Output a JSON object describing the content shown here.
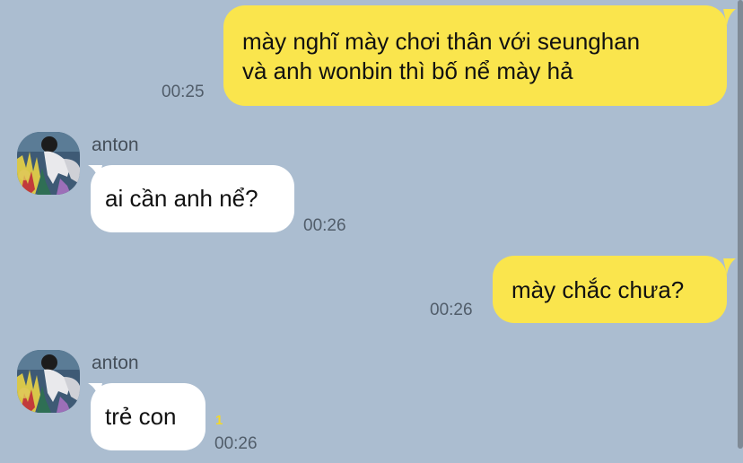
{
  "chat": {
    "background": "#abbdd0",
    "outgoing_bubble_color": "#fae54d",
    "incoming_bubble_color": "#ffffff",
    "messages": [
      {
        "direction": "outgoing",
        "lines": [
          "mày nghĩ mày chơi thân với seunghan",
          "và anh wonbin thì bố nể mày hả"
        ],
        "time": "00:25"
      },
      {
        "direction": "incoming",
        "sender": "anton",
        "avatar_icon": "profile-photo",
        "lines": [
          "ai cần anh nể?"
        ],
        "time": "00:26"
      },
      {
        "direction": "outgoing",
        "lines": [
          "mày chắc chưa?"
        ],
        "time": "00:26"
      },
      {
        "direction": "incoming",
        "sender": "anton",
        "avatar_icon": "profile-photo",
        "lines": [
          "trẻ con"
        ],
        "unread_count": "1",
        "time": "00:26"
      }
    ]
  }
}
